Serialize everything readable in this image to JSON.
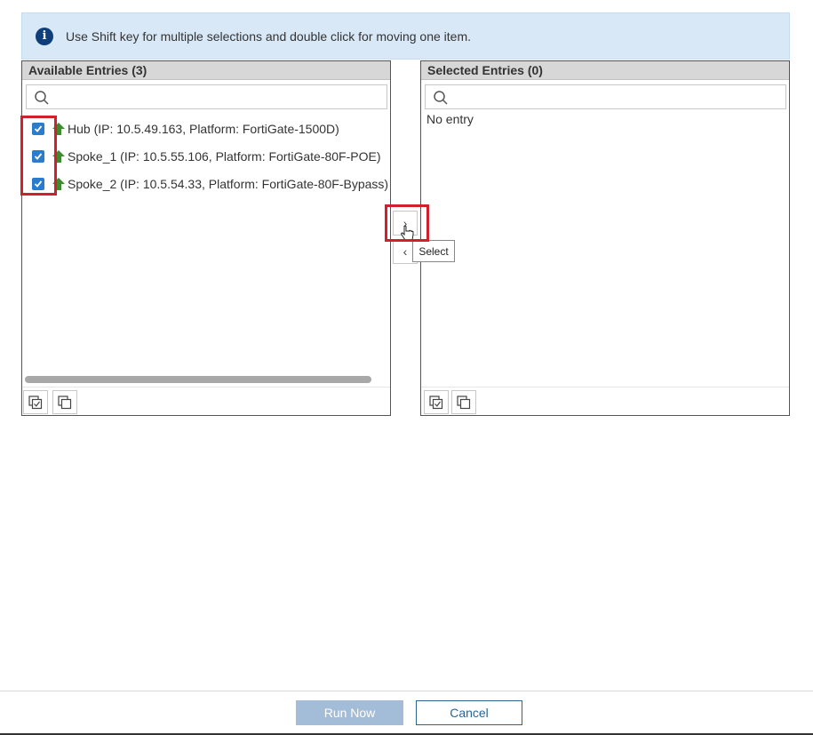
{
  "info": {
    "icon": "info-icon",
    "text": "Use Shift key for multiple selections and double click for moving one item."
  },
  "available": {
    "header": "Available Entries (3)",
    "search_placeholder": "",
    "entries": [
      {
        "label": "Hub (IP: 10.5.49.163, Platform: FortiGate-1500D)",
        "checked": true,
        "icon": "up-arrow-icon"
      },
      {
        "label": "Spoke_1 (IP: 10.5.55.106, Platform: FortiGate-80F-POE)",
        "checked": true,
        "icon": "up-arrow-icon"
      },
      {
        "label": "Spoke_2 (IP: 10.5.54.33, Platform: FortiGate-80F-Bypass)",
        "checked": true,
        "icon": "up-arrow-icon"
      }
    ]
  },
  "selected": {
    "header": "Selected Entries (0)",
    "search_placeholder": "",
    "empty_text": "No entry"
  },
  "move": {
    "select_symbol": "›",
    "deselect_symbol": "‹",
    "tooltip": "Select"
  },
  "footer": {
    "run_now": "Run Now",
    "cancel": "Cancel"
  },
  "colors": {
    "banner_bg": "#d9e8f7",
    "checkbox": "#2a7ccc",
    "up_arrow": "#3d8b2e",
    "primary_button": "#a3bcd8",
    "highlight": "#d0202e"
  }
}
